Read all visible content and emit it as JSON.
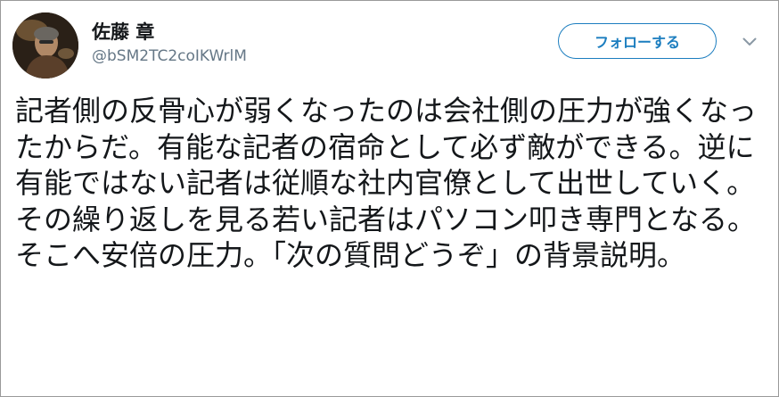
{
  "user": {
    "display_name": "佐藤 章",
    "handle": "@bSM2TC2coIKWrlM"
  },
  "actions": {
    "follow_label": "フォローする",
    "menu_icon": "chevron-down-icon"
  },
  "tweet": {
    "text": "記者側の反骨心が弱くなったのは会社側の圧力が強くなったからだ。有能な記者の宿命として必ず敵ができる。逆に有能ではない記者は従順な社内官僚として出世していく。その繰り返しを見る若い記者はパソコン叩き専門となる。そこへ安倍の圧力。「次の質問どうぞ」の背景説明。"
  },
  "colors": {
    "accent": "#1b7dbf",
    "text": "#14171a",
    "secondary": "#657786",
    "border": "#9a9a9a"
  }
}
